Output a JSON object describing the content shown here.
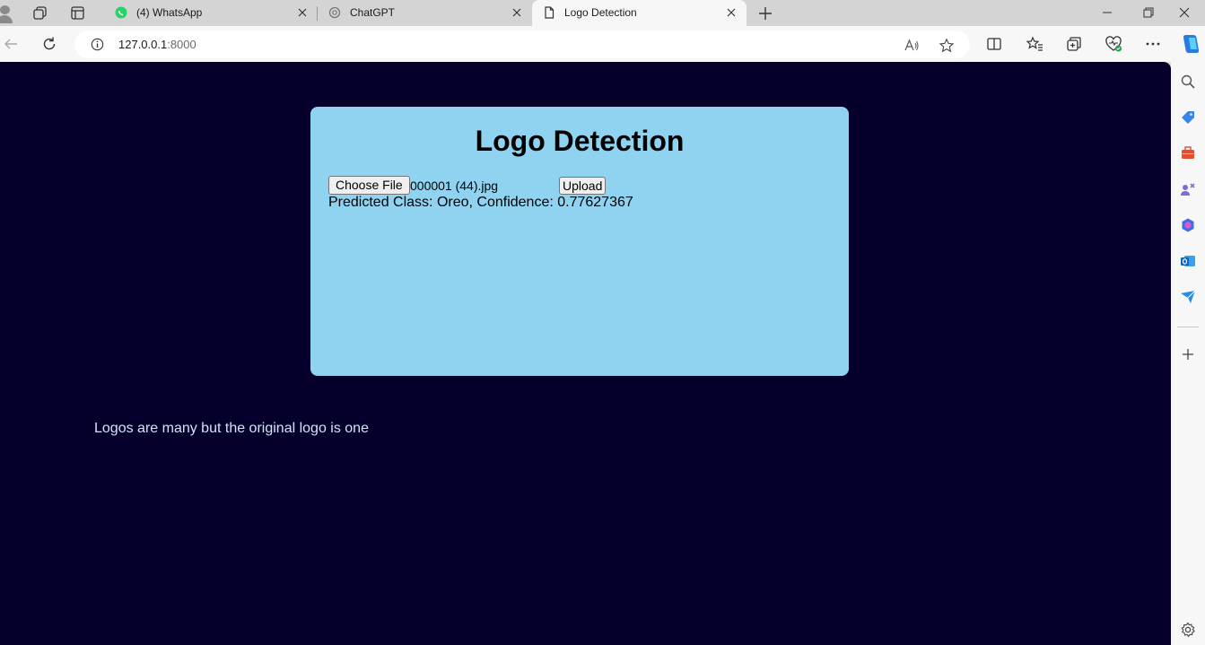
{
  "browser": {
    "tabs": [
      {
        "title": "(4) WhatsApp",
        "icon": "whatsapp-icon",
        "active": false
      },
      {
        "title": "ChatGPT",
        "icon": "chatgpt-icon",
        "active": false
      },
      {
        "title": "Logo Detection",
        "icon": "page-icon",
        "active": true
      }
    ],
    "url_host": "127.0.0.1",
    "url_port": ":8000",
    "accent_color": "#1a73e8"
  },
  "page": {
    "heading": "Logo Detection",
    "choose_file_label": "Choose File",
    "selected_file": "000001 (44).jpg",
    "upload_label": "Upload",
    "result": "Predicted Class: Oreo, Confidence: 0.77627367",
    "tagline": "Logos are many but the original logo is one",
    "background_color": "#05002b",
    "card_color": "#8fd3f0"
  }
}
